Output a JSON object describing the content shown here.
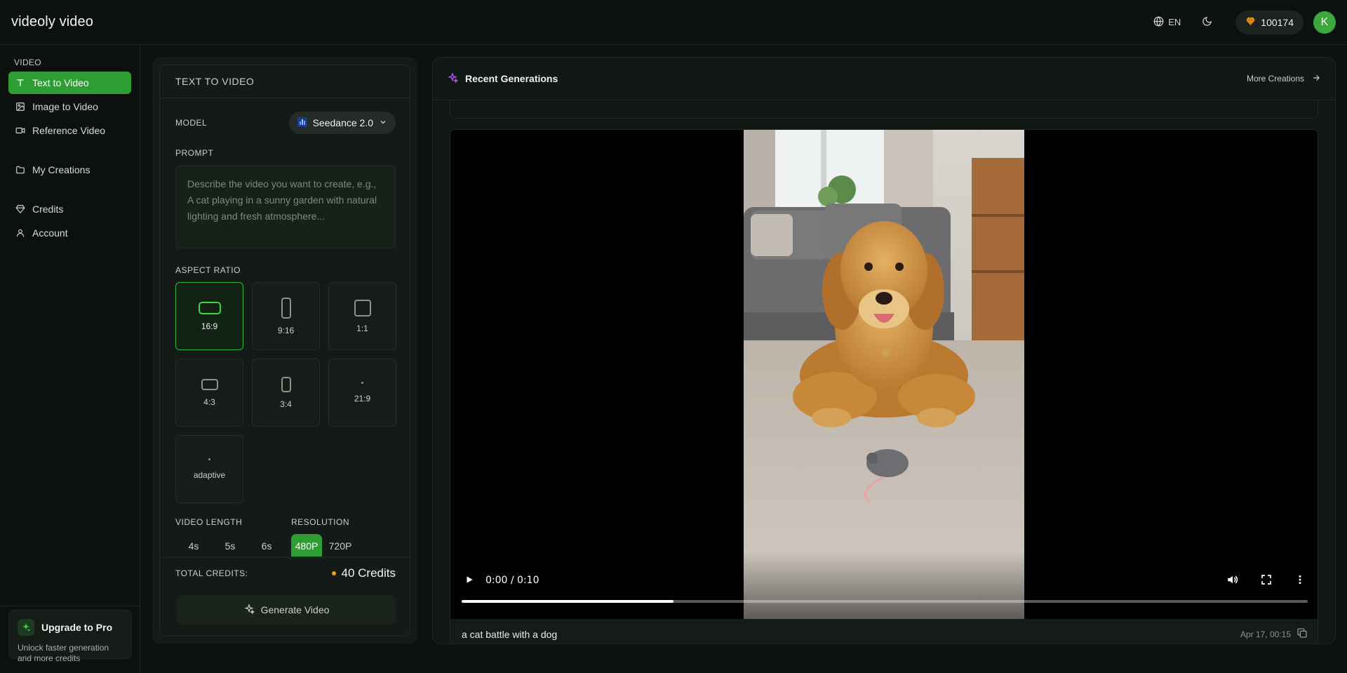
{
  "app": {
    "logo": "videoly video"
  },
  "topbar": {
    "language": "EN",
    "credits": "100174",
    "avatar_letter": "K"
  },
  "sidebar": {
    "section_video": "VIDEO",
    "items": [
      {
        "label": "Text to Video",
        "icon": "text-t-icon",
        "active": true
      },
      {
        "label": "Image to Video",
        "icon": "image-icon"
      },
      {
        "label": "Reference Video",
        "icon": "video-camera-icon"
      },
      {
        "label": "My Creations",
        "icon": "folder-icon"
      },
      {
        "label": "Credits",
        "icon": "gem-icon"
      },
      {
        "label": "Account",
        "icon": "user-icon"
      }
    ],
    "upgrade": {
      "title": "Upgrade to Pro",
      "subtitle": "Unlock faster generation and more credits"
    }
  },
  "form": {
    "title": "TEXT TO VIDEO",
    "model_label": "MODEL",
    "model_value": "Seedance 2.0",
    "prompt_label": "PROMPT",
    "prompt_placeholder": "Describe the video you want to create, e.g., A cat playing in a sunny garden with natural lighting and fresh atmosphere...",
    "aspect_label": "ASPECT RATIO",
    "aspect_ratios": [
      "16:9",
      "9:16",
      "1:1",
      "4:3",
      "3:4",
      "21:9",
      "adaptive"
    ],
    "aspect_selected": "16:9",
    "length_label": "VIDEO LENGTH",
    "lengths": [
      "4s",
      "5s",
      "6s"
    ],
    "resolution_label": "RESOLUTION",
    "resolutions": [
      "480P",
      "720P"
    ],
    "resolution_selected": "480P",
    "total_label": "TOTAL CREDITS:",
    "total_value": "40 Credits",
    "generate_label": "Generate Video"
  },
  "recent": {
    "title": "Recent Generations",
    "more_label": "More Creations",
    "video": {
      "time": "0:00 / 0:10",
      "progress": 0.25,
      "caption": "a cat battle with a dog",
      "date": "Apr 17, 00:15"
    }
  },
  "colors": {
    "accent": "#2e9e34",
    "background": "#0d110e",
    "credit_dot": "#f59e0b"
  }
}
